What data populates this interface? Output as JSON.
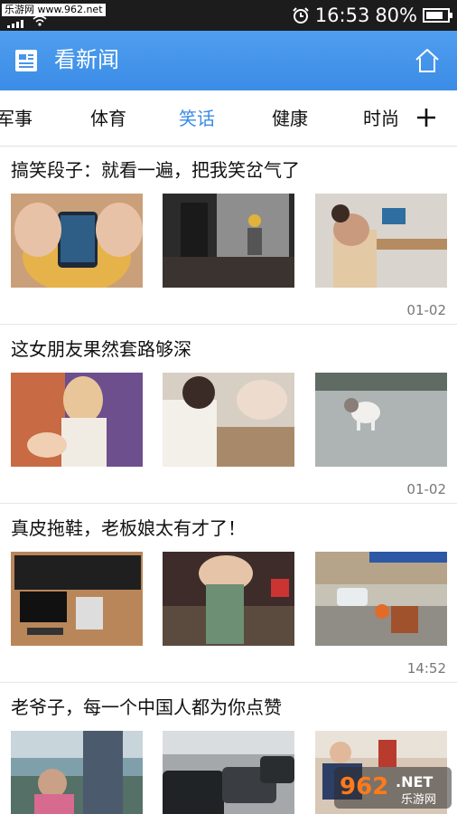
{
  "status_bar": {
    "watermark": "乐游网 www.962.net",
    "time": "16:53",
    "battery": "80%",
    "battery_level": 0.8
  },
  "app_bar": {
    "title": "看新闻",
    "menu_icon": "news-icon",
    "home_icon": "home-icon"
  },
  "tabs": {
    "items": [
      "军事",
      "体育",
      "笑话",
      "健康",
      "时尚"
    ],
    "active": "笑话",
    "add_icon": "plus-icon"
  },
  "news": [
    {
      "title": "搞笑段子：就看一遍，把我笑岔气了",
      "time": "01-02"
    },
    {
      "title": "这女朋友果然套路够深",
      "time": "01-02"
    },
    {
      "title": "真皮拖鞋，老板娘太有才了！",
      "time": "14:52"
    },
    {
      "title": "老爷子，每一个中国人都为你点赞",
      "time": ""
    }
  ],
  "watermark_logo": "962 NET 乐游网",
  "colors": {
    "accent": "#3b8ce6",
    "app_bar": "#4896ec",
    "status_bar": "#1c1c1c"
  }
}
